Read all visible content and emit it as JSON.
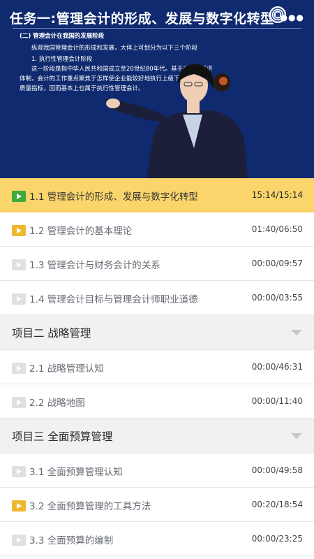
{
  "video": {
    "slide_title": "任务一:管理会计的形成、发展与数字化转型",
    "menu_icon": "more-dots",
    "logo_icon": "university-seal",
    "slide_lines": [
      "(二) 管理会计在我国的发展阶段",
      "纵观我国管理会计的形成和发展，大体上可划分为以下三个阶段",
      "1. 执行性管理会计阶段",
      "这一阶段是指中华人民共和国成立至20世纪80年代。基于当时的经济",
      "体制，会计的工作重点聚焦于怎样使企业能较好地执行上级下达的各项",
      "质量指标，因而基本上也属于执行性管理会计。"
    ]
  },
  "colors": {
    "accent": "#fbd56b",
    "play_active": "#3daa3b",
    "play_started": "#f0b830",
    "play_unstarted": "#e0e0e0",
    "video_bg": "#0f2a6e"
  },
  "lessons": [
    {
      "title": "1.1 管理会计的形成、发展与数字化转型",
      "duration": "15:14/15:14",
      "state": "playing"
    },
    {
      "title": "1.2 管理会计的基本理论",
      "duration": "01:40/06:50",
      "state": "started"
    },
    {
      "title": "1.3 管理会计与财务会计的关系",
      "duration": "00:00/09:57",
      "state": "unstarted"
    },
    {
      "title": "1.4 管理会计目标与管理会计师职业道德",
      "duration": "00:00/03:55",
      "state": "unstarted"
    }
  ],
  "sections": [
    {
      "title": "项目二  战略管理",
      "lessons": [
        {
          "title": "2.1 战略管理认知",
          "duration": "00:00/46:31",
          "state": "unstarted"
        },
        {
          "title": "2.2 战略地图",
          "duration": "00:00/11:40",
          "state": "unstarted"
        }
      ]
    },
    {
      "title": "项目三  全面预算管理",
      "lessons": [
        {
          "title": "3.1 全面预算管理认知",
          "duration": "00:00/49:58",
          "state": "unstarted"
        },
        {
          "title": "3.2 全面预算管理的工具方法",
          "duration": "00:20/18:54",
          "state": "started"
        },
        {
          "title": "3.3 全面预算的编制",
          "duration": "00:00/23:25",
          "state": "unstarted"
        }
      ]
    }
  ]
}
